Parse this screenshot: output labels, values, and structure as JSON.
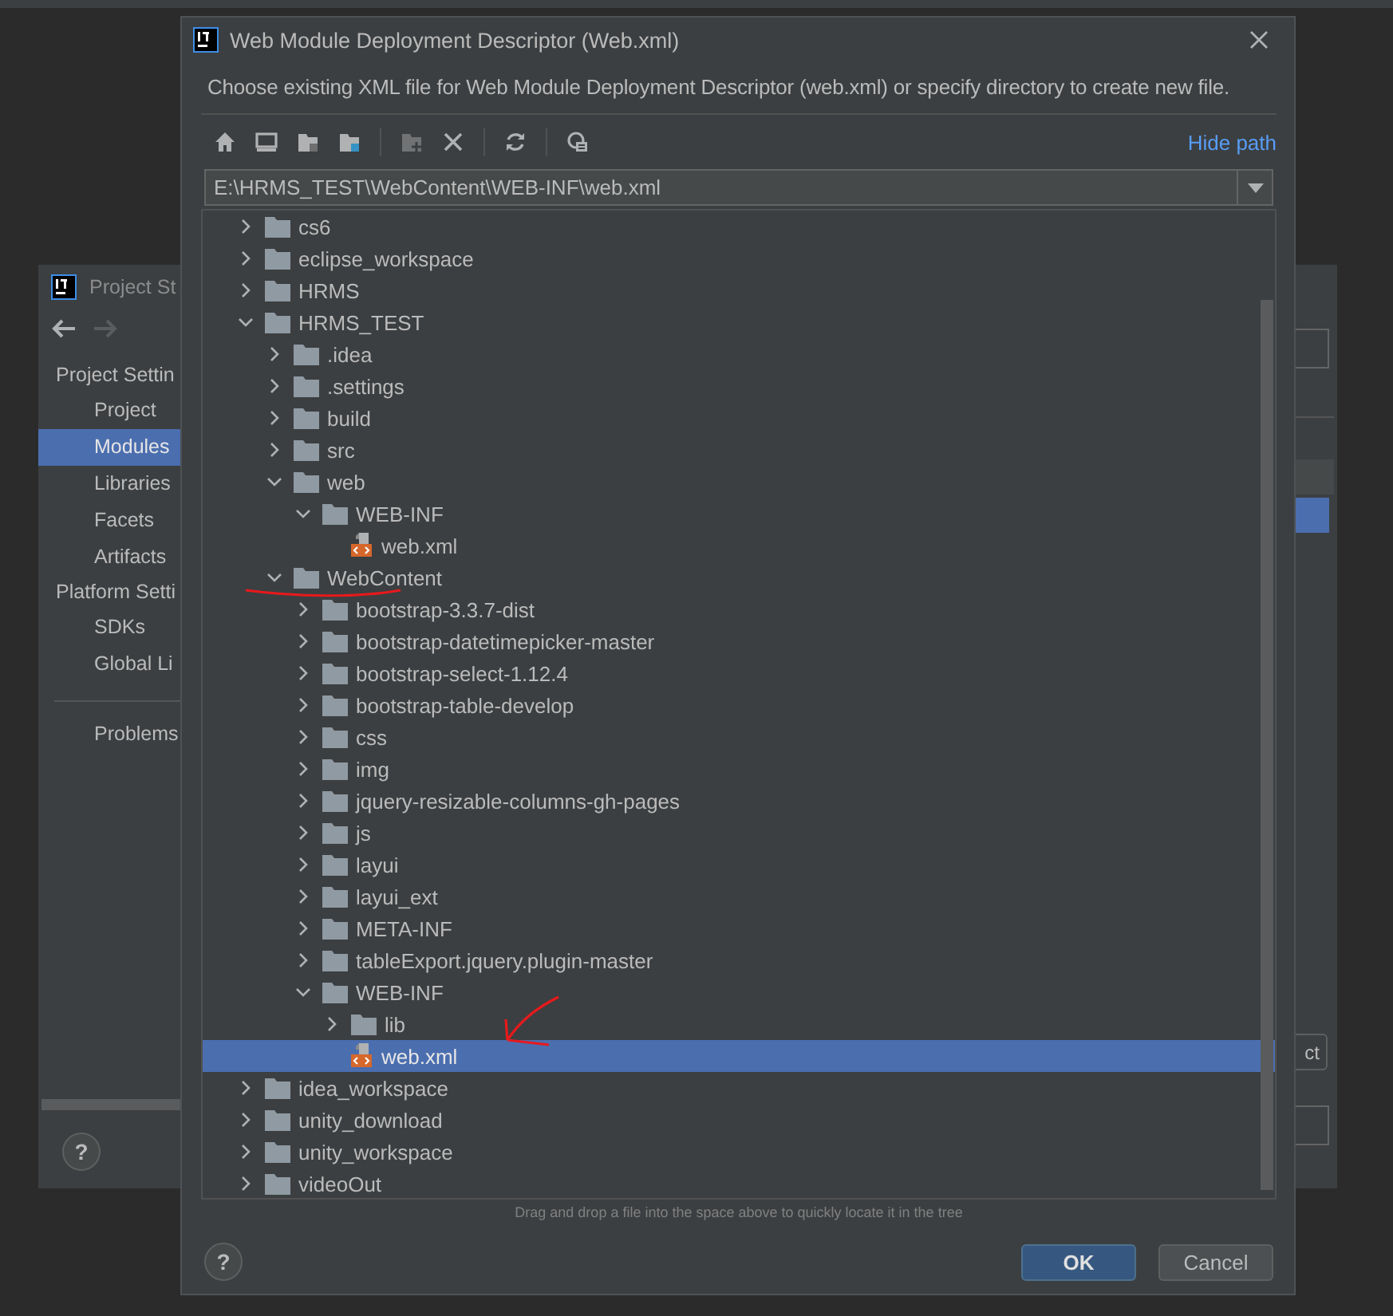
{
  "back_window": {
    "title": "Project St",
    "help": "?",
    "sidebar": [
      {
        "kind": "header",
        "label": "Project Settin"
      },
      {
        "kind": "item",
        "label": "Project",
        "selected": false
      },
      {
        "kind": "item",
        "label": "Modules",
        "selected": true
      },
      {
        "kind": "item",
        "label": "Libraries",
        "selected": false
      },
      {
        "kind": "item",
        "label": "Facets",
        "selected": false
      },
      {
        "kind": "item",
        "label": "Artifacts",
        "selected": false
      },
      {
        "kind": "header",
        "label": "Platform Setti"
      },
      {
        "kind": "item",
        "label": "SDKs",
        "selected": false
      },
      {
        "kind": "item",
        "label": "Global Li",
        "selected": false
      },
      {
        "kind": "divider"
      },
      {
        "kind": "item",
        "label": "Problems",
        "selected": false
      }
    ],
    "partial_button": "ct"
  },
  "dialog": {
    "title": "Web Module Deployment Descriptor (Web.xml)",
    "description": "Choose existing XML file for Web Module Deployment Descriptor (web.xml) or specify directory to create new file.",
    "toolbar": [
      {
        "kind": "home",
        "disabled": false
      },
      {
        "kind": "desktop",
        "disabled": false
      },
      {
        "kind": "project",
        "disabled": false
      },
      {
        "kind": "module",
        "disabled": false
      },
      {
        "kind": "separator"
      },
      {
        "kind": "new-folder",
        "disabled": true
      },
      {
        "kind": "delete",
        "disabled": false
      },
      {
        "kind": "separator"
      },
      {
        "kind": "refresh",
        "disabled": false
      },
      {
        "kind": "separator"
      },
      {
        "kind": "hidden-files",
        "disabled": false
      }
    ],
    "hide_path": "Hide path",
    "path": "E:\\HRMS_TEST\\WebContent\\WEB-INF\\web.xml",
    "tree": [
      {
        "label": "cs6",
        "kind": "folder",
        "expanded": false,
        "selected": false
      },
      {
        "label": "eclipse_workspace",
        "kind": "folder",
        "expanded": false,
        "selected": false
      },
      {
        "label": "HRMS",
        "kind": "folder",
        "expanded": false,
        "selected": false
      },
      {
        "label": "HRMS_TEST",
        "kind": "folder",
        "expanded": true,
        "selected": false,
        "children": [
          {
            "label": ".idea",
            "kind": "folder",
            "expanded": false,
            "selected": false
          },
          {
            "label": ".settings",
            "kind": "folder",
            "expanded": false,
            "selected": false
          },
          {
            "label": "build",
            "kind": "folder",
            "expanded": false,
            "selected": false
          },
          {
            "label": "src",
            "kind": "folder",
            "expanded": false,
            "selected": false
          },
          {
            "label": "web",
            "kind": "folder",
            "expanded": true,
            "selected": false,
            "children": [
              {
                "label": "WEB-INF",
                "kind": "folder",
                "expanded": true,
                "selected": false,
                "children": [
                  {
                    "label": "web.xml",
                    "kind": "file",
                    "selected": false
                  }
                ]
              }
            ]
          },
          {
            "label": "WebContent",
            "kind": "folder",
            "expanded": true,
            "selected": false,
            "annotations": [
              {
                "kind": "underline"
              }
            ],
            "children": [
              {
                "label": "bootstrap-3.3.7-dist",
                "kind": "folder",
                "expanded": false,
                "selected": false
              },
              {
                "label": "bootstrap-datetimepicker-master",
                "kind": "folder",
                "expanded": false,
                "selected": false
              },
              {
                "label": "bootstrap-select-1.12.4",
                "kind": "folder",
                "expanded": false,
                "selected": false
              },
              {
                "label": "bootstrap-table-develop",
                "kind": "folder",
                "expanded": false,
                "selected": false
              },
              {
                "label": "css",
                "kind": "folder",
                "expanded": false,
                "selected": false
              },
              {
                "label": "img",
                "kind": "folder",
                "expanded": false,
                "selected": false
              },
              {
                "label": "jquery-resizable-columns-gh-pages",
                "kind": "folder",
                "expanded": false,
                "selected": false
              },
              {
                "label": "js",
                "kind": "folder",
                "expanded": false,
                "selected": false
              },
              {
                "label": "layui",
                "kind": "folder",
                "expanded": false,
                "selected": false
              },
              {
                "label": "layui_ext",
                "kind": "folder",
                "expanded": false,
                "selected": false
              },
              {
                "label": "META-INF",
                "kind": "folder",
                "expanded": false,
                "selected": false
              },
              {
                "label": "tableExport.jquery.plugin-master",
                "kind": "folder",
                "expanded": false,
                "selected": false
              },
              {
                "label": "WEB-INF",
                "kind": "folder",
                "expanded": true,
                "selected": false,
                "children": [
                  {
                    "label": "lib",
                    "kind": "folder",
                    "expanded": false,
                    "selected": false
                  },
                  {
                    "label": "web.xml",
                    "kind": "file",
                    "selected": true,
                    "annotations": [
                      {
                        "kind": "arrow"
                      }
                    ]
                  }
                ]
              }
            ]
          }
        ]
      },
      {
        "label": "idea_workspace",
        "kind": "folder",
        "expanded": false,
        "selected": false
      },
      {
        "label": "unity_download",
        "kind": "folder",
        "expanded": false,
        "selected": false
      },
      {
        "label": "unity_workspace",
        "kind": "folder",
        "expanded": false,
        "selected": false
      },
      {
        "label": "videoOut",
        "kind": "folder",
        "expanded": false,
        "selected": false
      }
    ],
    "hint": "Drag and drop a file into the space above to quickly locate it in the tree",
    "help": "?",
    "buttons": [
      {
        "label": "OK",
        "kind": "primary"
      },
      {
        "label": "Cancel",
        "kind": "secondary"
      }
    ]
  }
}
